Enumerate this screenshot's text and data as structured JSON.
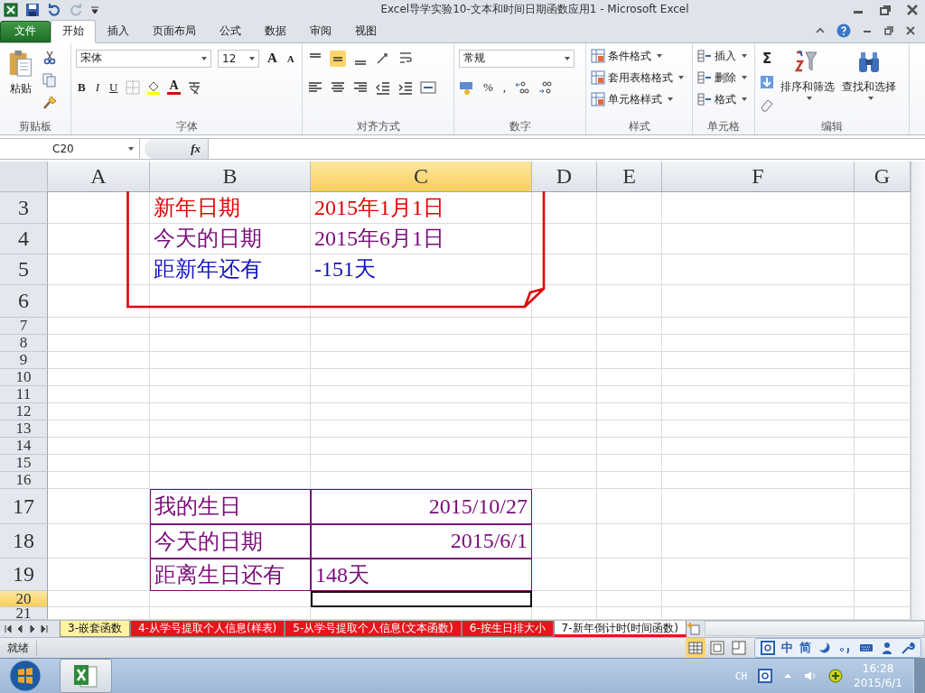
{
  "window": {
    "title": "Excel导学实验10-文本和时间日期函数应用1  -  Microsoft Excel"
  },
  "ribbon_tabs": [
    {
      "label": "文件",
      "kind": "file",
      "selected": false
    },
    {
      "label": "开始",
      "kind": "tab",
      "selected": true
    },
    {
      "label": "插入",
      "kind": "tab",
      "selected": false
    },
    {
      "label": "页面布局",
      "kind": "tab",
      "selected": false
    },
    {
      "label": "公式",
      "kind": "tab",
      "selected": false
    },
    {
      "label": "数据",
      "kind": "tab",
      "selected": false
    },
    {
      "label": "审阅",
      "kind": "tab",
      "selected": false
    },
    {
      "label": "视图",
      "kind": "tab",
      "selected": false
    }
  ],
  "clipboard": {
    "paste": "粘贴",
    "label": "剪贴板"
  },
  "font": {
    "name": "宋体",
    "size": "12",
    "grow": "A",
    "shrink": "A",
    "bold": "B",
    "italic": "I",
    "underline": "U",
    "color_letter": "A",
    "label": "字体"
  },
  "alignment": {
    "label": "对齐方式"
  },
  "number": {
    "format": "常规",
    "percent": "%",
    "comma": ",",
    "label": "数字"
  },
  "styles": {
    "items": [
      "条件格式",
      "套用表格格式",
      "单元格样式"
    ],
    "label": "样式"
  },
  "cells_group": {
    "items": [
      "插入",
      "删除",
      "格式"
    ],
    "label": "单元格"
  },
  "editing": {
    "sum": "Σ",
    "items": [
      "排序和筛选",
      "查找和选择"
    ],
    "label": "编辑"
  },
  "formula_bar": {
    "name_box": "C20",
    "fx": "fx"
  },
  "columns": [
    {
      "label": "A",
      "selected": false
    },
    {
      "label": "B",
      "selected": false
    },
    {
      "label": "C",
      "selected": true
    },
    {
      "label": "D",
      "selected": false
    },
    {
      "label": "E",
      "selected": false
    },
    {
      "label": "F",
      "selected": false
    },
    {
      "label": "G",
      "selected": false
    }
  ],
  "rows": [
    {
      "number": "3",
      "selected": false,
      "b": {
        "text": "新年日期",
        "color": "#e00000"
      },
      "c": {
        "text": "2015年1月1日",
        "color": "#e00000"
      }
    },
    {
      "number": "4",
      "selected": false,
      "b": {
        "text": "今天的日期",
        "color": "#7a0a7a"
      },
      "c": {
        "text": "2015年6月1日",
        "color": "#7a0a7a"
      }
    },
    {
      "number": "5",
      "selected": false,
      "b": {
        "text": "距新年还有",
        "color": "#1010c0"
      },
      "c": {
        "text": "-151天",
        "color": "#1010c0"
      }
    },
    {
      "number": "6",
      "selected": false
    },
    {
      "number": "7",
      "selected": false
    },
    {
      "number": "8",
      "selected": false
    },
    {
      "number": "9",
      "selected": false
    },
    {
      "number": "10",
      "selected": false
    },
    {
      "number": "11",
      "selected": false
    },
    {
      "number": "12",
      "selected": false
    },
    {
      "number": "13",
      "selected": false
    },
    {
      "number": "14",
      "selected": false
    },
    {
      "number": "15",
      "selected": false
    },
    {
      "number": "16",
      "selected": false
    },
    {
      "number": "17",
      "selected": false,
      "bordered": true,
      "b": {
        "text": "我的生日",
        "color": "#7a0a7a"
      },
      "c": {
        "text": "2015/10/27",
        "color": "#7a0a7a",
        "kind": "number"
      }
    },
    {
      "number": "18",
      "selected": false,
      "bordered": true,
      "b": {
        "text": "今天的日期",
        "color": "#7a0a7a"
      },
      "c": {
        "text": "2015/6/1",
        "color": "#7a0a7a",
        "kind": "number"
      }
    },
    {
      "number": "19",
      "selected": false,
      "bordered": true,
      "b": {
        "text": "距离生日还有",
        "color": "#7a0a7a"
      },
      "c": {
        "text": "148天",
        "color": "#7a0a7a"
      }
    },
    {
      "number": "20",
      "selected": true
    },
    {
      "number": "21",
      "selected": false
    }
  ],
  "sheet_tabs": [
    {
      "label": "3-嵌套函数",
      "color": "#fff3a0",
      "selected": false
    },
    {
      "label": "4-从学号提取个人信息(样表)",
      "color": "#e8141c",
      "selected": false
    },
    {
      "label": "5-从学号提取个人信息(文本函数)",
      "color": "#e8141c",
      "selected": false
    },
    {
      "label": "6-按生日排大小",
      "color": "#e8141c",
      "selected": false
    },
    {
      "label": "7-新年倒计时(时间函数)",
      "color": "#e8141c",
      "selected": true
    }
  ],
  "status_bar": {
    "text": "就绪"
  },
  "ime_bar": {
    "items": [
      "中",
      "简"
    ]
  },
  "taskbar": {
    "language": "CH",
    "time": "16:28",
    "date": "2015/6/1"
  }
}
